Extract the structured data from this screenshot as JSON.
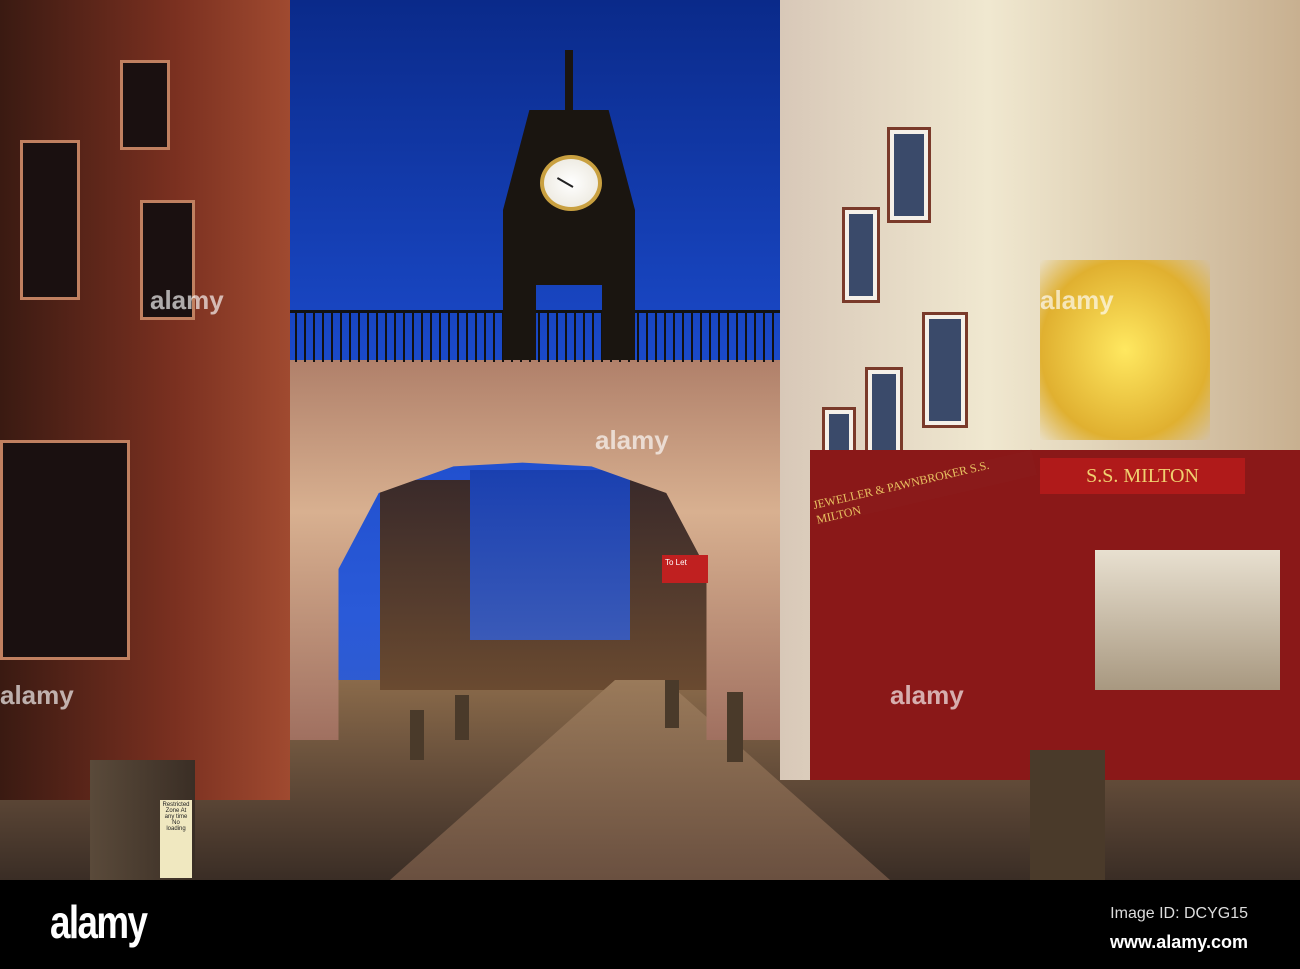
{
  "photo": {
    "shop_sign": "S.S. MILTON",
    "shop_sign_side": "JEWELLER & PAWNBROKER S.S. MILTON",
    "to_let_sign": "To Let",
    "restricted_sign": "Restricted Zone At any time No loading",
    "watermark": "alamy"
  },
  "footer": {
    "logo": "alamy",
    "image_id": "Image ID: DCYG15",
    "url": "www.alamy.com"
  }
}
